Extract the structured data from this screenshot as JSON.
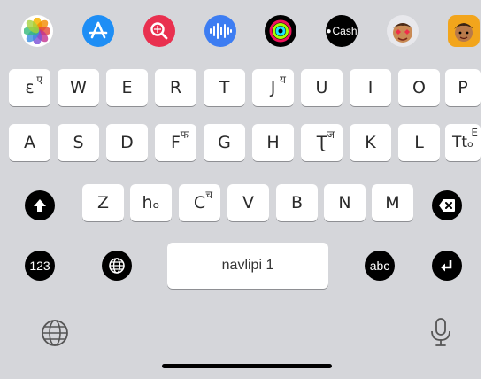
{
  "app_strip": {
    "apps": [
      {
        "name": "photos-app-icon"
      },
      {
        "name": "app-store-app-icon"
      },
      {
        "name": "image-search-app-icon"
      },
      {
        "name": "audio-app-icon"
      },
      {
        "name": "fitness-app-icon"
      },
      {
        "name": "cash-app-icon",
        "label": "Cash"
      },
      {
        "name": "memoji-stickers-app-icon"
      },
      {
        "name": "memoji-app-icon"
      }
    ]
  },
  "keyboard": {
    "row1": [
      {
        "main": "ɛ",
        "sup": "ए"
      },
      {
        "main": "W",
        "sup": ""
      },
      {
        "main": "E",
        "sup": ""
      },
      {
        "main": "R",
        "sup": ""
      },
      {
        "main": "T",
        "sup": ""
      },
      {
        "main": "J",
        "sup": "य"
      },
      {
        "main": "U",
        "sup": ""
      },
      {
        "main": "I",
        "sup": ""
      },
      {
        "main": "O",
        "sup": ""
      },
      {
        "main": "P",
        "sup": ""
      }
    ],
    "row2": [
      {
        "main": "A",
        "sup": ""
      },
      {
        "main": "S",
        "sup": ""
      },
      {
        "main": "D",
        "sup": ""
      },
      {
        "main": "F",
        "sup": "फ"
      },
      {
        "main": "G",
        "sup": ""
      },
      {
        "main": "H",
        "sup": ""
      },
      {
        "main": "Ʈ",
        "sup": "ज"
      },
      {
        "main": "K",
        "sup": ""
      },
      {
        "main": "L",
        "sup": ""
      },
      {
        "main": "Ttₒ",
        "sup": "E"
      }
    ],
    "row3": [
      {
        "main": "Z",
        "sup": ""
      },
      {
        "main": "hₒ",
        "sup": ""
      },
      {
        "main": "C",
        "sup": "च"
      },
      {
        "main": "V",
        "sup": ""
      },
      {
        "main": "B",
        "sup": ""
      },
      {
        "main": "N",
        "sup": ""
      },
      {
        "main": "M",
        "sup": ""
      }
    ],
    "numbers_label": "123",
    "abc_label": "abc",
    "space_label": "navlipi 1"
  },
  "icons": {
    "shift": "shift-icon",
    "delete": "delete-icon",
    "globe": "globe-icon",
    "return": "return-icon",
    "mic": "microphone-icon"
  }
}
